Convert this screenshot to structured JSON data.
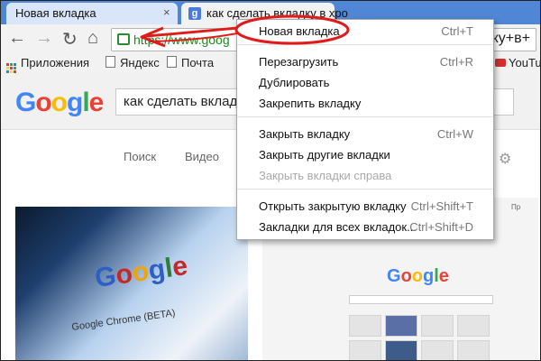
{
  "tabs": [
    {
      "title": "Новая вкладка",
      "close": "×"
    },
    {
      "title": "как сделать вкладку в хро",
      "favicon": "g"
    }
  ],
  "toolbar": {
    "back": "←",
    "forward": "→",
    "reload": "↻",
    "home": "⌂",
    "url_left": "https://www.goog",
    "url_right": "вкладку+в+"
  },
  "bookmarks": {
    "apps": "Приложения",
    "items": [
      "Яндекс",
      "Почта"
    ],
    "youtube": "YouTu"
  },
  "google": {
    "search_text": "как сделать вклад",
    "tabs": [
      "Поиск",
      "Видео"
    ]
  },
  "images": {
    "left_logo": "Google",
    "left_sub": "Google Chrome (BETA)",
    "right_logo": "Google",
    "right_thumb_label": "Пр"
  },
  "menu": {
    "items": [
      {
        "label": "Новая вкладка",
        "shortcut": "Ctrl+T",
        "enabled": true
      },
      {
        "label": "Перезагрузить",
        "shortcut": "Ctrl+R",
        "enabled": true
      },
      {
        "label": "Дублировать",
        "shortcut": "",
        "enabled": true
      },
      {
        "label": "Закрепить вкладку",
        "shortcut": "",
        "enabled": true
      },
      {
        "label": "Закрыть вкладку",
        "shortcut": "Ctrl+W",
        "enabled": true
      },
      {
        "label": "Закрыть другие вкладки",
        "shortcut": "",
        "enabled": true
      },
      {
        "label": "Закрыть вкладки справа",
        "shortcut": "",
        "enabled": false
      },
      {
        "label": "Открыть закрытую вкладку",
        "shortcut": "Ctrl+Shift+T",
        "enabled": true
      },
      {
        "label": "Закладки для всех вкладок...",
        "shortcut": "Ctrl+Shift+D",
        "enabled": true
      }
    ]
  },
  "colors": {
    "tabstrip": "#4f86d6",
    "annotation_red": "#e01b1b",
    "url_green": "#1a8a1a",
    "google_blue": "#4285f4",
    "google_red": "#ea4335",
    "google_yellow": "#fbbc05",
    "google_green": "#34a853"
  }
}
